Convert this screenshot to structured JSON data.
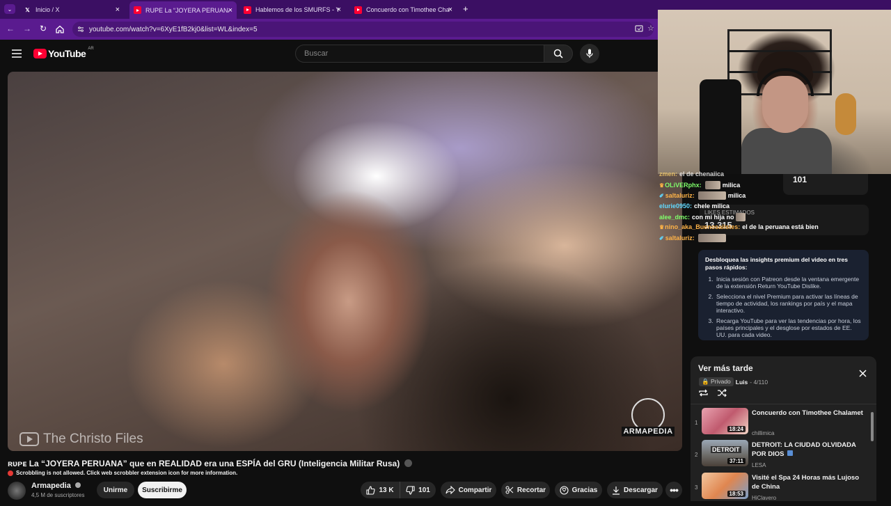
{
  "browser": {
    "tabs": [
      {
        "label": "Inicio / X",
        "icon": "x-logo-icon",
        "active": false
      },
      {
        "label": "RUPE La “JOYERA PERUANA” que",
        "icon": "youtube-icon",
        "active": true
      },
      {
        "label": "Hablemos de los SMURFS - You",
        "icon": "youtube-icon",
        "active": false
      },
      {
        "label": "Concuerdo con Timothee Chala",
        "icon": "youtube-icon",
        "active": false
      }
    ],
    "url": "youtube.com/watch?v=6XyE1fB2kj0&list=WL&index=5",
    "colors": {
      "tabbar": "#3b0f63",
      "active_tab": "#5a1b8f"
    }
  },
  "youtube": {
    "logo_text": "YouTube",
    "country_code": "AR",
    "search_placeholder": "Buscar"
  },
  "video": {
    "watermark": "The Christo Files",
    "channel_logo_text": "ARMAPEDIA",
    "title": "ʀᴜᴘᴇ La “JOYERA PERUANA” que en REALIDAD era una ESPÍA del GRU (Inteligencia Militar Rusa)",
    "scrobbler_notice": "Scrobbling is not allowed. Click web scrobbler extension icon for more information.",
    "channel": {
      "name": "Armapedia",
      "subscribers": "4,5 M de suscriptores"
    },
    "buttons": {
      "join": "Unirme",
      "subscribe": "Suscribirme",
      "likes": "13 K",
      "dislikes": "101",
      "share": "Compartir",
      "clip": "Recortar",
      "thanks": "Gracias",
      "download": "Descargar"
    }
  },
  "overlay": {
    "dislike_count": "101",
    "ghost_label": "LIKES ESTIMADOS",
    "ghost_value": "13.315",
    "chat": [
      {
        "user": "zmen: ",
        "msg": "el de chenaiica",
        "color": "#ffd36b"
      },
      {
        "user": "OLiVERphx:",
        "msg": "milica",
        "color": "#7fff6a",
        "emote": true
      },
      {
        "user": "saltaluriz:",
        "msg": "milica",
        "color": "#ffb347",
        "emote": true
      },
      {
        "user": "elurie0950:",
        "msg": "chele milica",
        "color": "#61d9ff"
      },
      {
        "user": "alee_dmc:",
        "msg": "con mi hija no",
        "color": "#7fff6a",
        "emote": true
      },
      {
        "user": "nino_aka_Buenosaiistes:",
        "msg": "el de la peruana está bien",
        "color": "#ffb347"
      },
      {
        "user": "saltaluriz:",
        "msg": "",
        "color": "#ffb347",
        "emote": true
      }
    ]
  },
  "premium": {
    "heading": "Desbloquea las insights premium del video en tres pasos rápidos:",
    "steps": [
      "Inicia sesión con Patreon desde la ventana emergente de la extensión Return YouTube Dislike.",
      "Selecciona el nivel Premium para activar las líneas de tiempo de actividad, los rankings por país y el mapa interactivo.",
      "Recarga YouTube para ver las tendencias por hora, los países principales y el desglose por estados de EE. UU. para cada video."
    ]
  },
  "playlist": {
    "title": "Ver más tarde",
    "privacy": "Privado",
    "owner": "Luis",
    "position": "- 4/110",
    "items": [
      {
        "index": "1",
        "title": "Concuerdo con Timothee Chalamet",
        "channel": "chillimica",
        "duration": "18:24"
      },
      {
        "index": "2",
        "title": "DETROIT: LA CIUDAD OLVIDADA POR DIOS",
        "channel": "LESA",
        "duration": "37:11",
        "thumb_text": "DETROIT"
      },
      {
        "index": "3",
        "title": "Visité el Spa 24 Horas más Lujoso de China",
        "channel": "HiClavero",
        "duration": "18:53"
      }
    ]
  }
}
